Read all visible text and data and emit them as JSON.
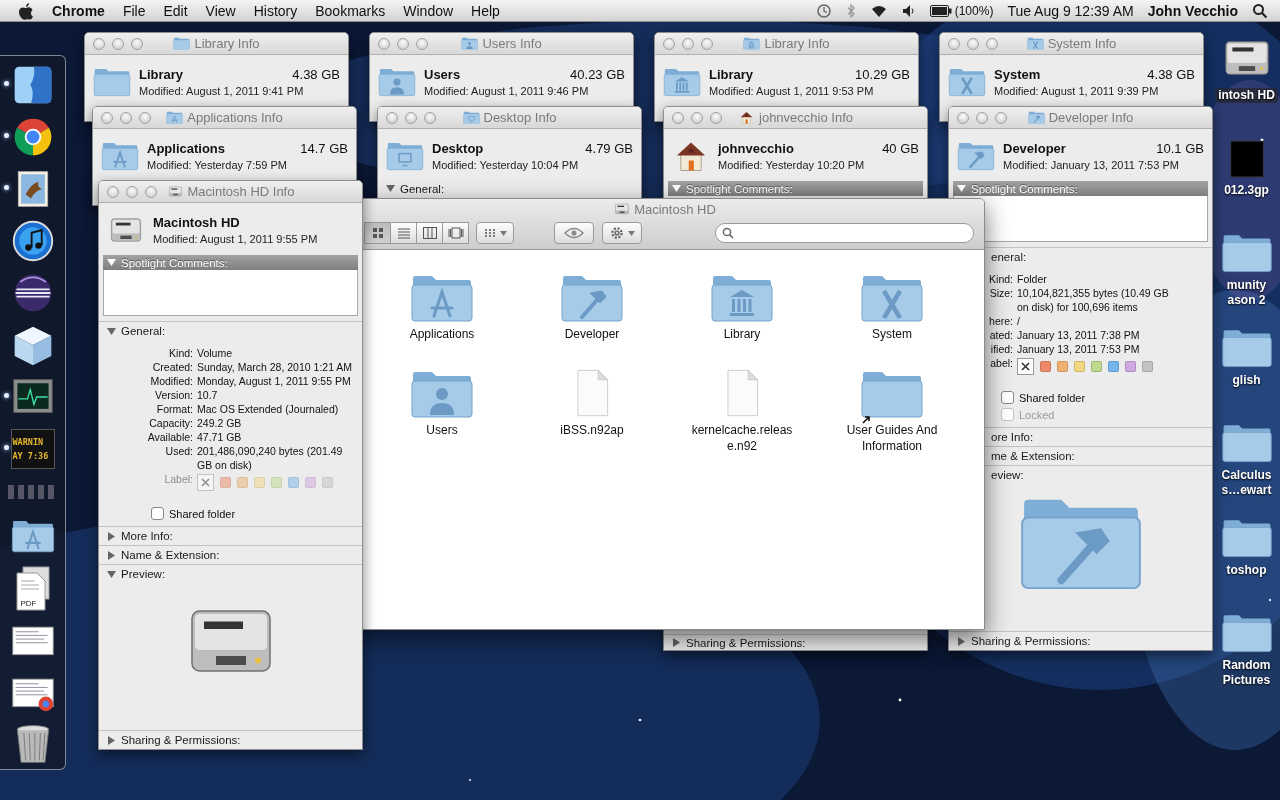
{
  "menu_bar": {
    "app_name": "Chrome",
    "menus": [
      "File",
      "Edit",
      "View",
      "History",
      "Bookmarks",
      "Window",
      "Help"
    ],
    "battery": "(100%)",
    "clock": "Tue Aug 9 12:39 AM",
    "user": "John Vecchio"
  },
  "dock": {
    "apps": [
      {
        "kind": "finder",
        "running": true
      },
      {
        "kind": "browser",
        "running": true
      },
      {
        "kind": "mail",
        "running": true
      },
      {
        "kind": "music",
        "running": false
      },
      {
        "kind": "sphere",
        "running": false
      },
      {
        "kind": "cube",
        "running": false
      },
      {
        "kind": "activity",
        "running": true
      },
      {
        "kind": "console",
        "running": true,
        "display": [
          "WARNIN",
          "AY 7:36"
        ]
      }
    ],
    "stacks": [
      {
        "kind": "applications"
      },
      {
        "kind": "documents",
        "label": "PDF"
      },
      {
        "kind": "window"
      },
      {
        "kind": "browser_window"
      },
      {
        "kind": "trash"
      }
    ]
  },
  "desktop_icons": [
    {
      "kind": "disk",
      "label": [
        "intosh HD"
      ],
      "selected": true
    },
    {
      "kind": "video",
      "label": [
        "012.3gp"
      ],
      "selected": false
    },
    {
      "kind": "folder",
      "label": [
        "munity",
        "ason 2"
      ],
      "selected": false
    },
    {
      "kind": "folder",
      "label": [
        "glish"
      ],
      "selected": false
    },
    {
      "kind": "folder",
      "label": [
        "Calculus",
        "s…ewart"
      ],
      "selected": false
    },
    {
      "kind": "folder",
      "label": [
        "toshop"
      ],
      "selected": false
    },
    {
      "kind": "folder",
      "label": [
        "Random",
        "Pictures"
      ],
      "selected": false
    }
  ],
  "info_windows": [
    {
      "title": "Library Info",
      "kind": "folder",
      "name": "Library",
      "size": "4.38 GB",
      "modified": "Modified: August 1, 2011 9:41 PM"
    },
    {
      "title": "Users Info",
      "kind": "users",
      "name": "Users",
      "size": "40.23 GB",
      "modified": "Modified: August 1, 2011 9:46 PM"
    },
    {
      "title": "Library Info",
      "kind": "library",
      "name": "Library",
      "size": "10.29 GB",
      "modified": "Modified: August 1, 2011 9:53 PM"
    },
    {
      "title": "System Info",
      "kind": "system",
      "name": "System",
      "size": "4.38 GB",
      "modified": "Modified: August 1, 2011 9:39 PM"
    },
    {
      "title": "Applications Info",
      "kind": "applications",
      "name": "Applications",
      "size": "14.7 GB",
      "modified": "Modified: Yesterday 7:59 PM"
    },
    {
      "title": "Desktop Info",
      "kind": "desktop",
      "name": "Desktop",
      "size": "4.79 GB",
      "modified": "Modified: Yesterday 10:04 PM",
      "sections": [
        {
          "kind": "general",
          "title": "General:",
          "expanded": true
        }
      ]
    },
    {
      "title": "johnvecchio Info",
      "kind": "home",
      "name": "johnvecchio",
      "size": "40 GB",
      "modified": "Modified: Yesterday 10:20 PM",
      "sections": [
        {
          "kind": "comments",
          "title": "Spotlight Comments:",
          "expanded": true
        },
        {
          "kind": "sharing",
          "title": "Sharing & Permissions:",
          "expanded": false
        }
      ]
    },
    {
      "title": "Developer Info",
      "kind": "developer",
      "name": "Developer",
      "size": "10.1 GB",
      "modified": "Modified: January 13, 2011 7:53 PM",
      "sections": [
        {
          "kind": "comments",
          "title": "Spotlight Comments:",
          "expanded": true
        },
        {
          "kind": "general",
          "title": "eneral:",
          "expanded": true,
          "fields": [
            {
              "label": "Kind:",
              "value": "Folder"
            },
            {
              "label": "Size:",
              "value": "10,104,821,355 bytes (10.49 GB on disk) for 100,696 items"
            },
            {
              "label": "here:",
              "value": "/"
            },
            {
              "label": "ated:",
              "value": "January 13, 2011 7:38 PM"
            },
            {
              "label": "ified:",
              "value": "January 13, 2011 7:53 PM"
            }
          ],
          "label_picker": {
            "label": "abel:",
            "disabled": false
          },
          "checkboxes": [
            {
              "label": "Shared folder",
              "checked": false,
              "disabled": false
            },
            {
              "label": "Locked",
              "checked": false,
              "disabled": true
            }
          ]
        },
        {
          "kind": "more_info",
          "title": "ore Info:"
        },
        {
          "kind": "name_extension",
          "title": "me & Extension:"
        },
        {
          "kind": "preview",
          "title": "eview:",
          "expanded": true
        },
        {
          "kind": "sharing",
          "title": "Sharing & Permissions:",
          "expanded": false
        }
      ]
    },
    {
      "title": "Macintosh HD Info",
      "kind": "disk",
      "name": "Macintosh HD",
      "modified": "Modified: August 1, 2011 9:55 PM",
      "sections": [
        {
          "kind": "comments",
          "title": "Spotlight Comments:",
          "expanded": true
        },
        {
          "kind": "general",
          "title": "General:",
          "expanded": true,
          "fields": [
            {
              "label": "Kind:",
              "value": "Volume"
            },
            {
              "label": "Created:",
              "value": "Sunday, March 28, 2010 1:21 AM"
            },
            {
              "label": "Modified:",
              "value": "Monday, August 1, 2011 9:55 PM"
            },
            {
              "label": "Version:",
              "value": "10.7"
            },
            {
              "label": "Format:",
              "value": "Mac OS Extended (Journaled)"
            },
            {
              "label": "Capacity:",
              "value": "249.2 GB"
            },
            {
              "label": "Available:",
              "value": "47.71 GB"
            },
            {
              "label": "Used:",
              "value": "201,486,090,240 bytes (201.49 GB on disk)"
            }
          ],
          "label_picker": {
            "label": "Label:",
            "disabled": true
          },
          "checkboxes": [
            {
              "label": "Shared folder",
              "checked": false,
              "disabled": false
            }
          ]
        },
        {
          "kind": "more_info",
          "title": "More Info:",
          "expanded": false
        },
        {
          "kind": "name_extension",
          "title": "Name & Extension:",
          "expanded": false
        },
        {
          "kind": "preview",
          "title": "Preview:",
          "expanded": true
        },
        {
          "kind": "sharing",
          "title": "Sharing & Permissions:",
          "expanded": false
        }
      ]
    }
  ],
  "finder_window": {
    "title": "Macintosh HD",
    "view_modes": [
      {
        "kind": "icon",
        "selected": true
      },
      {
        "kind": "list",
        "selected": false
      },
      {
        "kind": "columns",
        "selected": false
      },
      {
        "kind": "coverflow",
        "selected": false
      }
    ],
    "items": [
      {
        "name": "Applications",
        "kind": "applications",
        "alias": false
      },
      {
        "name": "Developer",
        "kind": "developer",
        "alias": false
      },
      {
        "name": "Library",
        "kind": "library",
        "alias": false
      },
      {
        "name": "System",
        "kind": "system",
        "alias": false
      },
      {
        "name": "Users",
        "kind": "users",
        "alias": false
      },
      {
        "name": "iBSS.n92ap",
        "kind": "document",
        "alias": false
      },
      {
        "name": "kernelcache.release.n92",
        "kind": "document",
        "alias": false
      },
      {
        "name": "User Guides And Information",
        "kind": "folder",
        "alias": true
      }
    ]
  }
}
